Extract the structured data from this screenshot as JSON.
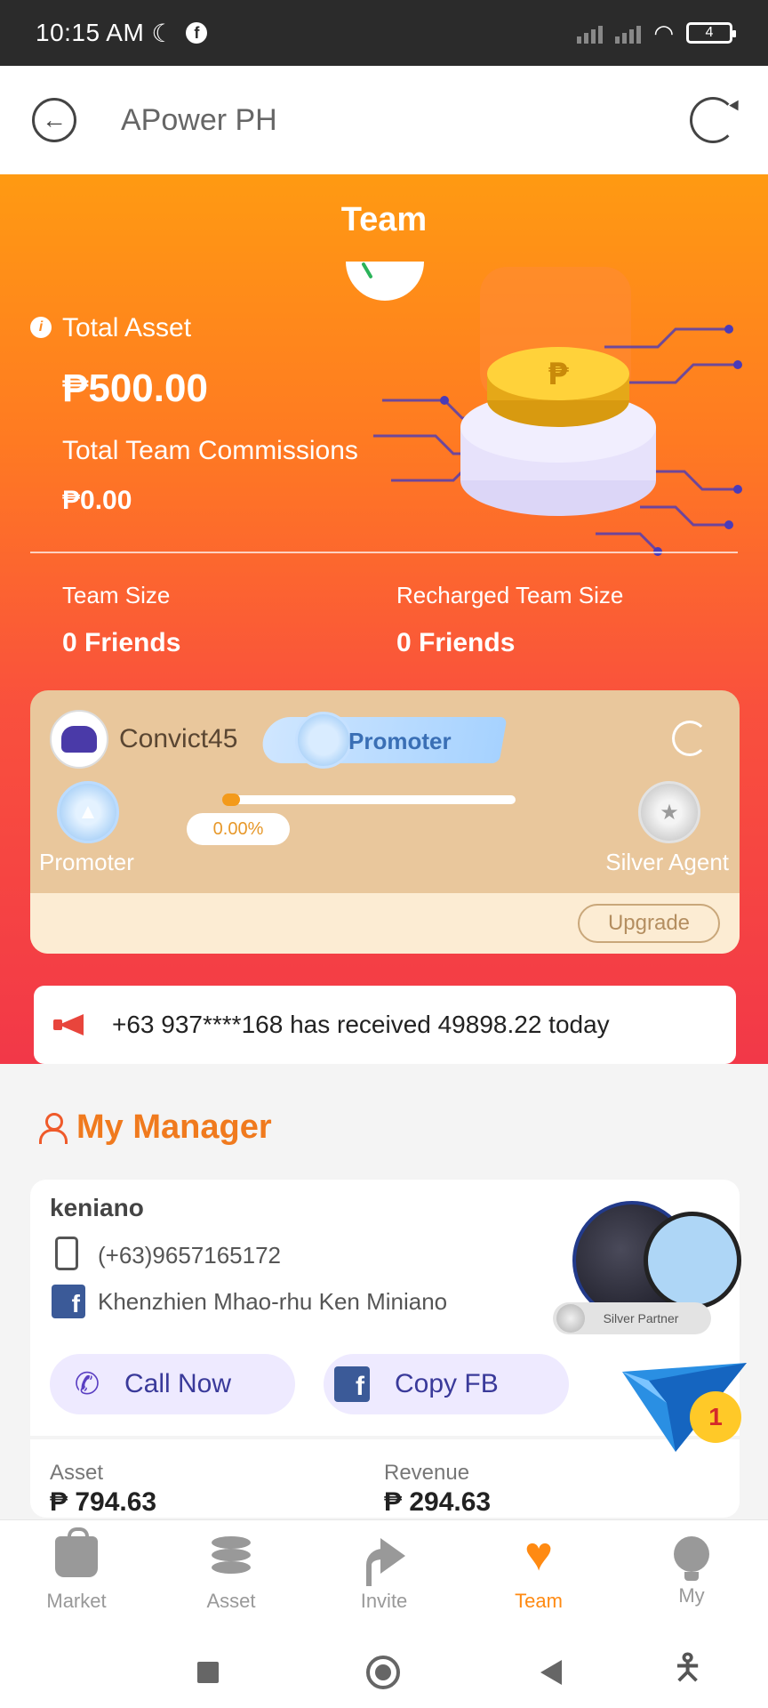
{
  "status_bar": {
    "time": "10:15 AM",
    "battery": "4"
  },
  "app_bar": {
    "title": "APower PH"
  },
  "hero": {
    "title": "Team",
    "total_asset_label": "Total Asset",
    "total_asset_value": "₱500.00",
    "commission_label": "Total Team Commissions",
    "commission_value": "₱0.00",
    "team_size_label": "Team Size",
    "team_size_value": "0 Friends",
    "recharged_label": "Recharged Team Size",
    "recharged_value": "0 Friends"
  },
  "level_card": {
    "username": "Convict45",
    "rank": "Promoter",
    "progress_text": "0.00%",
    "progress_value": 0.0,
    "current_level": "Promoter",
    "next_level": "Silver Agent",
    "upgrade_label": "Upgrade"
  },
  "ticker": {
    "text": "+63 937****168 has received 49898.22 today"
  },
  "manager": {
    "section_title": "My Manager",
    "name": "keniano",
    "phone": "(+63)9657165172",
    "facebook": "Khenzhien Mhao-rhu Ken Miniano",
    "badge": "Silver Partner",
    "call_label": "Call Now",
    "copy_fb_label": "Copy FB",
    "notification_count": "1",
    "asset_label": "Asset",
    "asset_value": "₱ 794.63",
    "revenue_label": "Revenue",
    "revenue_value": "₱ 294.63"
  },
  "bottom_nav": {
    "items": [
      {
        "label": "Market",
        "icon": "bag-icon"
      },
      {
        "label": "Asset",
        "icon": "coin-stack-icon"
      },
      {
        "label": "Invite",
        "icon": "share-icon"
      },
      {
        "label": "Team",
        "icon": "heart-handshake-icon",
        "active": true
      },
      {
        "label": "My",
        "icon": "bulb-profile-icon"
      }
    ],
    "active_color": "#ff8a12"
  },
  "colors": {
    "hero_top": "#ff9a12",
    "hero_bottom": "#f23848",
    "accent_orange": "#f07a1e",
    "button_bg": "#eeeaff"
  }
}
